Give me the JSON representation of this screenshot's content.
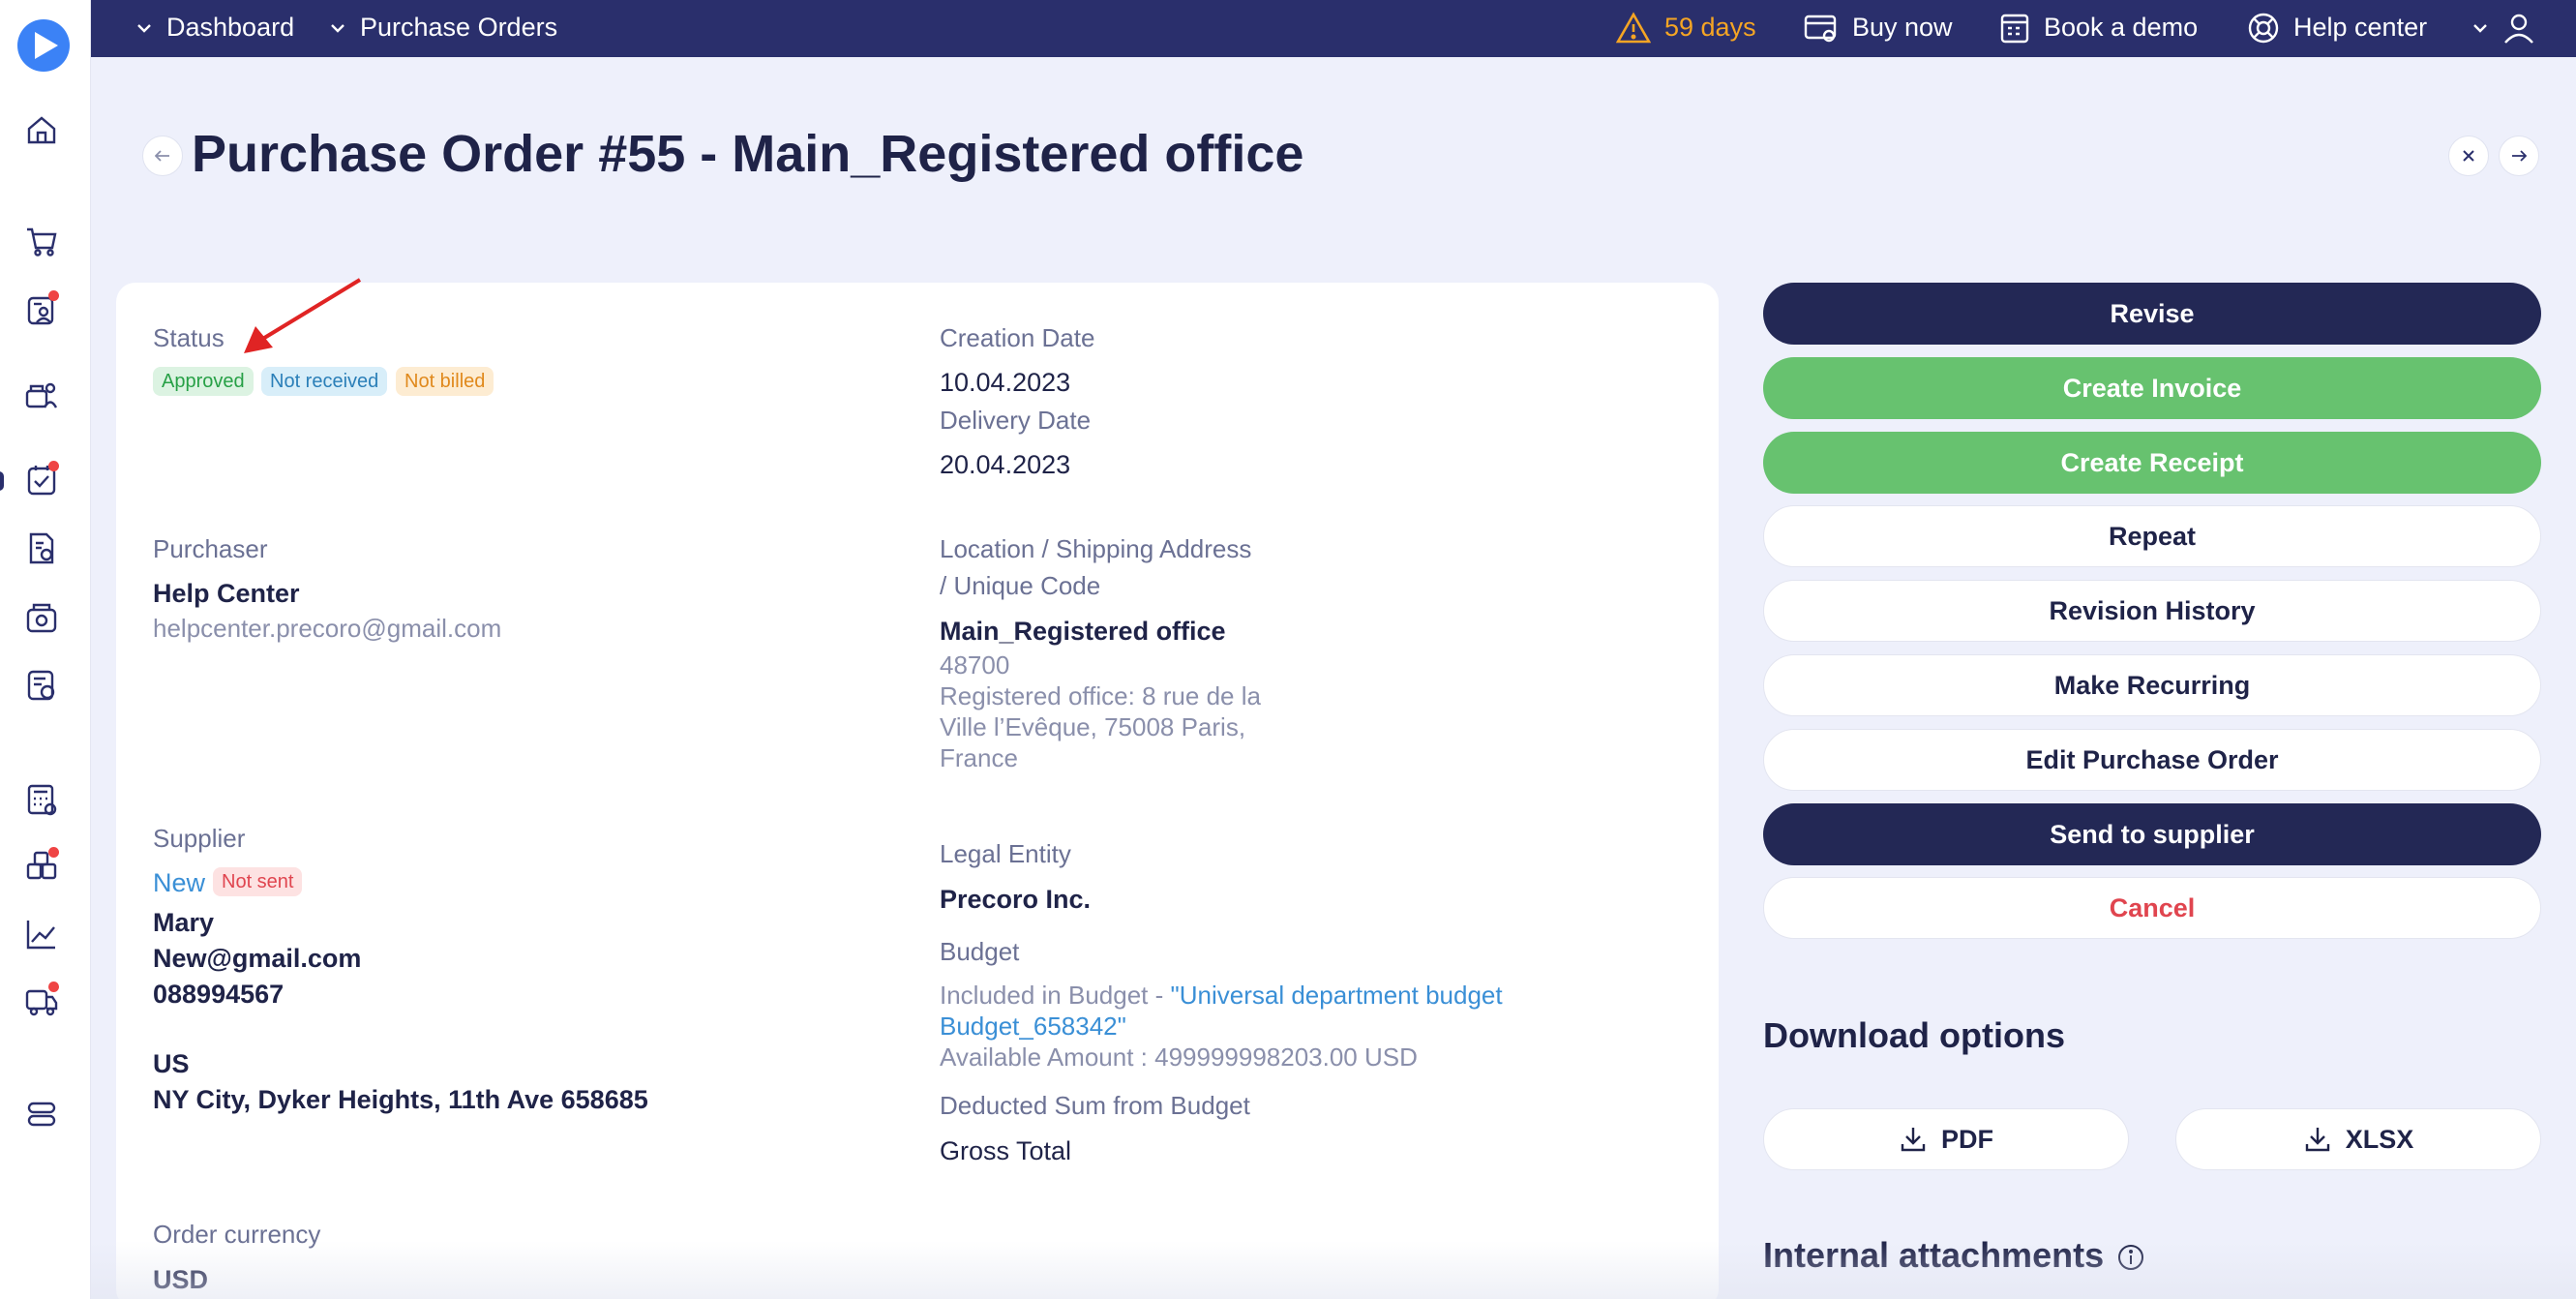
{
  "topbar": {
    "breadcrumbs": [
      "Dashboard",
      "Purchase Orders"
    ],
    "trial": "59 days",
    "buy_now": "Buy now",
    "book_demo": "Book a demo",
    "help_center": "Help center"
  },
  "page": {
    "title": "Purchase Order #55 - Main_Registered office"
  },
  "details": {
    "status_label": "Status",
    "status_badges": [
      "Approved",
      "Not received",
      "Not billed"
    ],
    "creation_date_label": "Creation Date",
    "creation_date": "10.04.2023",
    "delivery_date_label": "Delivery Date",
    "delivery_date": "20.04.2023",
    "purchaser_label": "Purchaser",
    "purchaser_name": "Help Center",
    "purchaser_email": "helpcenter.precoro@gmail.com",
    "location_label_1": "Location / Shipping Address",
    "location_label_2": "/ Unique Code",
    "location_name": "Main_Registered office",
    "location_code": "48700",
    "location_address_1": "Registered office: 8 rue de la",
    "location_address_2": "Ville l’Evêque, 75008 Paris,",
    "location_address_3": "France",
    "supplier_label": "Supplier",
    "supplier_name": "New",
    "supplier_badge": "Not sent",
    "supplier_contact": "Mary",
    "supplier_email": "New@gmail.com",
    "supplier_phone": "088994567",
    "supplier_country": "US",
    "supplier_address": "NY City, Dyker Heights, 11th Ave 658685",
    "legal_entity_label": "Legal Entity",
    "legal_entity": "Precoro Inc.",
    "budget_label": "Budget",
    "budget_included_prefix": "Included in Budget - ",
    "budget_link_1": "\"Universal department budget",
    "budget_link_2": "Budget_658342\"",
    "budget_available": "Available Amount : 499999998203.00 USD",
    "deducted_label": "Deducted Sum from Budget",
    "deducted_value": "Gross Total",
    "currency_label": "Order currency",
    "currency": "USD"
  },
  "actions": {
    "revise": "Revise",
    "create_invoice": "Create Invoice",
    "create_receipt": "Create Receipt",
    "repeat": "Repeat",
    "revision_history": "Revision History",
    "make_recurring": "Make Recurring",
    "edit": "Edit Purchase Order",
    "send": "Send to supplier",
    "cancel": "Cancel"
  },
  "download": {
    "heading": "Download options",
    "pdf": "PDF",
    "xlsx": "XLSX"
  },
  "attachments": {
    "heading": "Internal attachments"
  },
  "colors": {
    "topbar": "#2a2f6c",
    "primary_dark": "#232855",
    "green": "#67c26f",
    "danger": "#e0454f",
    "link": "#3a8fd6"
  },
  "icons": {
    "sidebar": [
      "home-icon",
      "cart-icon",
      "requests-icon",
      "suppliers-icon",
      "approvals-icon",
      "documents-icon",
      "payments-icon",
      "invoices-icon",
      "calculator-icon",
      "inventory-icon",
      "analytics-icon",
      "delivery-icon",
      "settings-icon"
    ]
  }
}
